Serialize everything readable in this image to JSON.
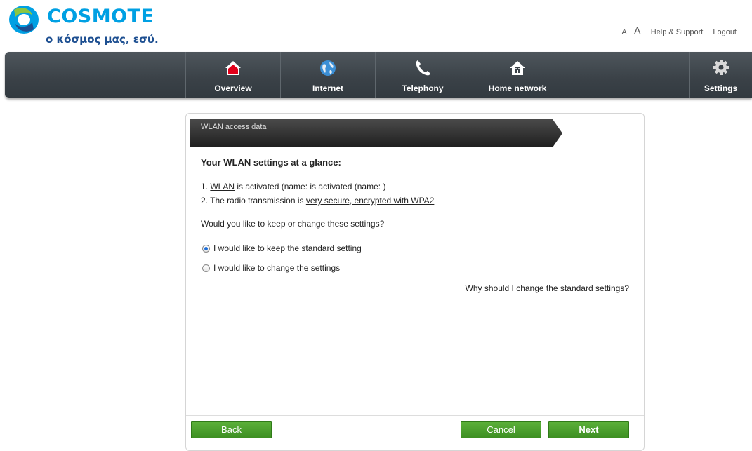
{
  "header": {
    "brand": "COSMOTE",
    "slogan": "ο κόσμος μας, εσύ.",
    "links": {
      "font_small": "A",
      "font_large": "A",
      "help": "Help & Support",
      "logout": "Logout"
    }
  },
  "nav": {
    "items": [
      {
        "label": "Overview",
        "icon": "home-icon"
      },
      {
        "label": "Internet",
        "icon": "globe-icon"
      },
      {
        "label": "Telephony",
        "icon": "phone-icon"
      },
      {
        "label": "Home network",
        "icon": "home-network-icon"
      }
    ],
    "settings": {
      "label": "Settings",
      "icon": "gear-icon"
    }
  },
  "panel": {
    "ribbon_title": "WLAN access data",
    "title": "Your WLAN settings at a glance:",
    "line1_prefix": "1. ",
    "line1_link": "WLAN",
    "line1_suffix": " is activated (name: is activated (name: )",
    "line2_prefix": "2. The radio transmission is ",
    "line2_link": "very secure, encrypted with WPA2",
    "question": "Would you like to keep or change these settings?",
    "options": [
      {
        "label": "I would like to keep the standard setting",
        "selected": true
      },
      {
        "label": "I would like to change the settings",
        "selected": false
      }
    ],
    "why_link": "Why should I change the standard settings?"
  },
  "buttons": {
    "back": "Back",
    "cancel": "Cancel",
    "next": "Next"
  },
  "colors": {
    "brand_blue": "#00a0e3",
    "nav_bg": "#3a4147",
    "button_green": "#4ca42e",
    "radio_selected": "#1e6fd9"
  }
}
